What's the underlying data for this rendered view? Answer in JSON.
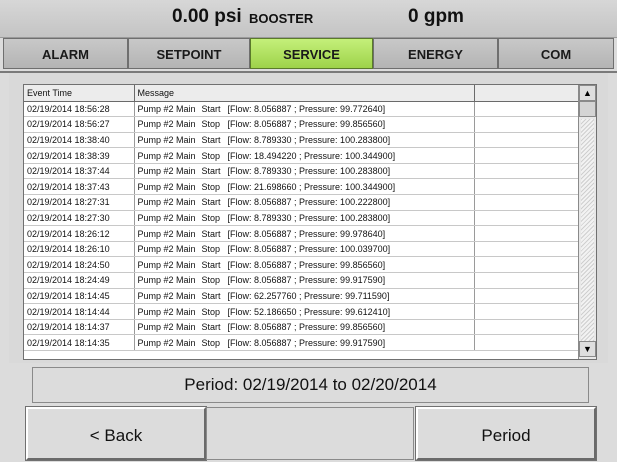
{
  "status": {
    "pressure": "0.00 psi",
    "mode": "BOOSTER",
    "flow": "0 gpm"
  },
  "tabs": [
    "ALARM",
    "SETPOINT",
    "SERVICE",
    "ENERGY",
    "COM"
  ],
  "active_tab": "SERVICE",
  "log": {
    "headers": [
      "Event Time",
      "Message",
      ""
    ],
    "rows": [
      {
        "time": "02/19/2014 18:56:28",
        "name": "Pump #2 Main",
        "action": "Start",
        "detail": "[Flow: 8.056887 ; Pressure: 99.772640]"
      },
      {
        "time": "02/19/2014 18:56:27",
        "name": "Pump #2 Main",
        "action": "Stop",
        "detail": "[Flow: 8.056887 ; Pressure: 99.856560]"
      },
      {
        "time": "02/19/2014 18:38:40",
        "name": "Pump #2 Main",
        "action": "Start",
        "detail": "[Flow: 8.789330 ; Pressure: 100.283800]"
      },
      {
        "time": "02/19/2014 18:38:39",
        "name": "Pump #2 Main",
        "action": "Stop",
        "detail": "[Flow: 18.494220 ; Pressure: 100.344900]"
      },
      {
        "time": "02/19/2014 18:37:44",
        "name": "Pump #2 Main",
        "action": "Start",
        "detail": "[Flow: 8.789330 ; Pressure: 100.283800]"
      },
      {
        "time": "02/19/2014 18:37:43",
        "name": "Pump #2 Main",
        "action": "Stop",
        "detail": "[Flow: 21.698660 ; Pressure: 100.344900]"
      },
      {
        "time": "02/19/2014 18:27:31",
        "name": "Pump #2 Main",
        "action": "Start",
        "detail": "[Flow: 8.056887 ; Pressure: 100.222800]"
      },
      {
        "time": "02/19/2014 18:27:30",
        "name": "Pump #2 Main",
        "action": "Stop",
        "detail": "[Flow: 8.789330 ; Pressure: 100.283800]"
      },
      {
        "time": "02/19/2014 18:26:12",
        "name": "Pump #2 Main",
        "action": "Start",
        "detail": "[Flow: 8.056887 ; Pressure: 99.978640]"
      },
      {
        "time": "02/19/2014 18:26:10",
        "name": "Pump #2 Main",
        "action": "Stop",
        "detail": "[Flow: 8.056887 ; Pressure: 100.039700]"
      },
      {
        "time": "02/19/2014 18:24:50",
        "name": "Pump #2 Main",
        "action": "Start",
        "detail": "[Flow: 8.056887 ; Pressure: 99.856560]"
      },
      {
        "time": "02/19/2014 18:24:49",
        "name": "Pump #2 Main",
        "action": "Stop",
        "detail": "[Flow: 8.056887 ; Pressure: 99.917590]"
      },
      {
        "time": "02/19/2014 18:14:45",
        "name": "Pump #2 Main",
        "action": "Start",
        "detail": "[Flow: 62.257760 ; Pressure: 99.711590]"
      },
      {
        "time": "02/19/2014 18:14:44",
        "name": "Pump #2 Main",
        "action": "Stop",
        "detail": "[Flow: 52.186650 ; Pressure: 99.612410]"
      },
      {
        "time": "02/19/2014 18:14:37",
        "name": "Pump #2 Main",
        "action": "Start",
        "detail": "[Flow: 8.056887 ; Pressure: 99.856560]"
      },
      {
        "time": "02/19/2014 18:14:35",
        "name": "Pump #2 Main",
        "action": "Stop",
        "detail": "[Flow: 8.056887 ; Pressure: 99.917590]"
      }
    ]
  },
  "period": "Period: 02/19/2014 to 02/20/2014",
  "buttons": {
    "back": "< Back",
    "period": "Period"
  },
  "icons": {
    "scroll_up": "scroll-up-arrow",
    "scroll_down": "scroll-down-arrow"
  },
  "colors": {
    "active_tab": "#b2e05e",
    "background": "#dcdcdc"
  }
}
